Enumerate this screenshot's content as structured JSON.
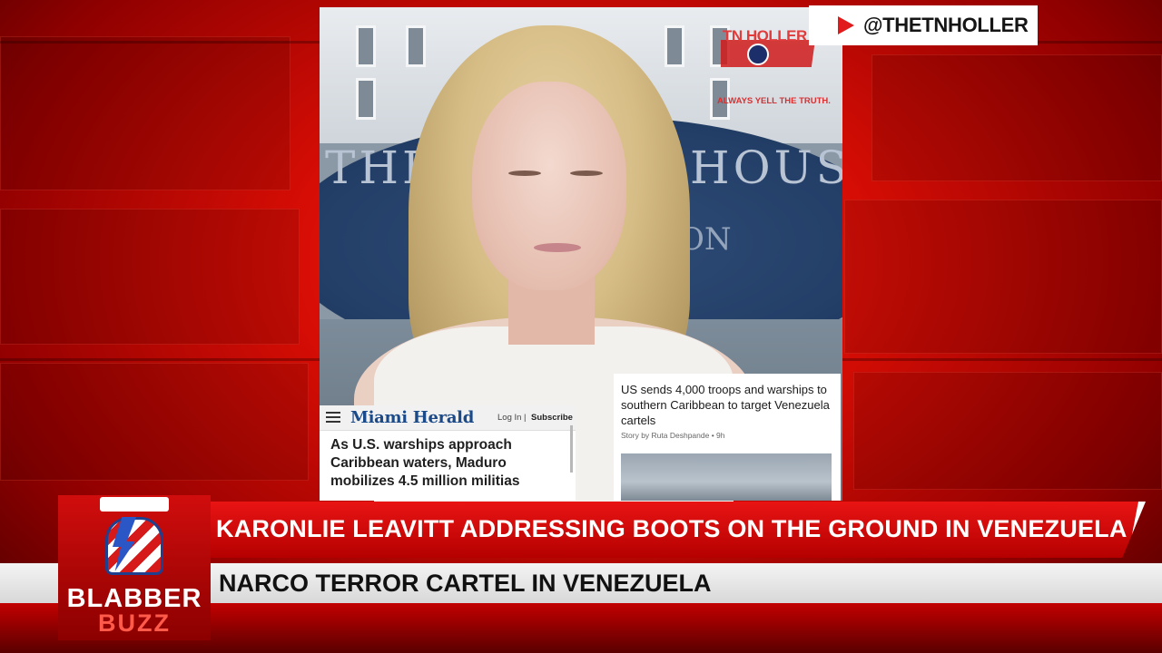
{
  "channel_handle": "@THETNHOLLER",
  "watermark": {
    "name": "TN HOLLER",
    "tagline": "ALWAYS YELL THE TRUTH."
  },
  "background_text": {
    "seal_line": "THE HOUSE",
    "seal_small": "ON"
  },
  "article_miami": {
    "logo": "Miami Herald",
    "login": "Log In  |",
    "subscribe": "Subscribe",
    "headline": "As U.S. warships approach Caribbean waters, Maduro mobilizes 4.5 million militias"
  },
  "article_us": {
    "headline": "US sends 4,000 troops and warships to southern Caribbean to target Venezuela cartels",
    "byline": "Story by Ruta Deshpande • 9h"
  },
  "brand": {
    "line1": "BLABBER",
    "line2": "BUZZ"
  },
  "lower_third": {
    "headline": "KARONLIE LEAVITT ADDRESSING BOOTS ON THE GROUND IN VENEZUELA",
    "subheadline": "NARCO TERROR CARTEL IN VENEZUELA"
  },
  "colors": {
    "accent_red": "#e91414",
    "dark_red": "#8c0000",
    "brand_blue": "#1f3f8f"
  }
}
